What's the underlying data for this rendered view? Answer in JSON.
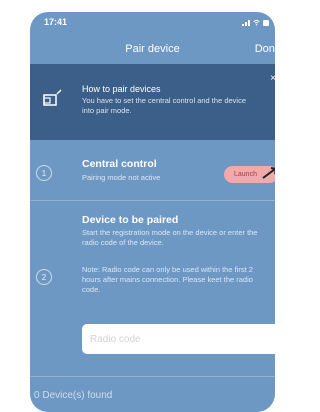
{
  "status_bar": {
    "time": "17:41"
  },
  "nav": {
    "title": "Pair device",
    "done_label": "Done"
  },
  "howto": {
    "title": "How to pair devices",
    "text": "You have to set the central control and the device into pair mode.",
    "close_label": "×"
  },
  "central_control": {
    "step": "1",
    "title": "Central control",
    "status": "Pairing mode not active",
    "launch_label": "Launch"
  },
  "device_to_pair": {
    "step": "2",
    "title": "Device to be paired",
    "text": "Start the registration mode on the device or enter the radio code of the device.",
    "note": "Note: Radio code can only be used within the first 2 hours after mains connection. Please keet the radio code.",
    "radio_code_placeholder": "Radio code"
  },
  "footer": {
    "found_text": "0 Device(s) found"
  },
  "colors": {
    "background": "#6e98c4",
    "banner": "#3b5f88",
    "launch_bg": "#f2a9ac",
    "launch_text": "#b03a3f"
  }
}
